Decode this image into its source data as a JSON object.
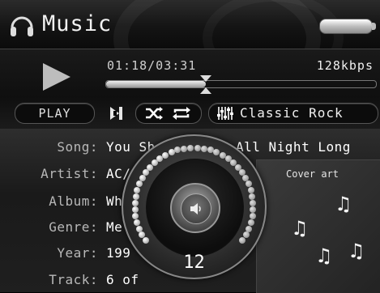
{
  "header": {
    "title": "Music",
    "icon": "headphones-icon",
    "battery_icon": "battery-icon"
  },
  "transport": {
    "time": "01:18/03:31",
    "bitrate": "128kbps",
    "progress_fraction": 0.37,
    "play_label": "PLAY",
    "equalizer_preset": "Classic Rock",
    "icons": [
      "play-icon",
      "next-track-icon",
      "shuffle-icon",
      "repeat-icon",
      "equalizer-icon"
    ]
  },
  "track_info": {
    "rows": [
      {
        "label": "Song:",
        "value": "You Sh"
      },
      {
        "label": "Artist:",
        "value": "AC/"
      },
      {
        "label": "Album:",
        "value": "Wh"
      },
      {
        "label": "Genre:",
        "value": "Me"
      },
      {
        "label": "Year:",
        "value": "199"
      },
      {
        "label": "Track:",
        "value": "6 of"
      }
    ],
    "song_tail": "All Night Long"
  },
  "cover": {
    "label": "Cover art",
    "icon": "music-note-icon"
  },
  "volume": {
    "value": "12",
    "level_fraction": 0.4,
    "icon": "speaker-icon"
  },
  "colors": {
    "background": "#000000",
    "panel": "#1f1f1f",
    "text": "#ffffff",
    "label": "#b8b8b8"
  }
}
